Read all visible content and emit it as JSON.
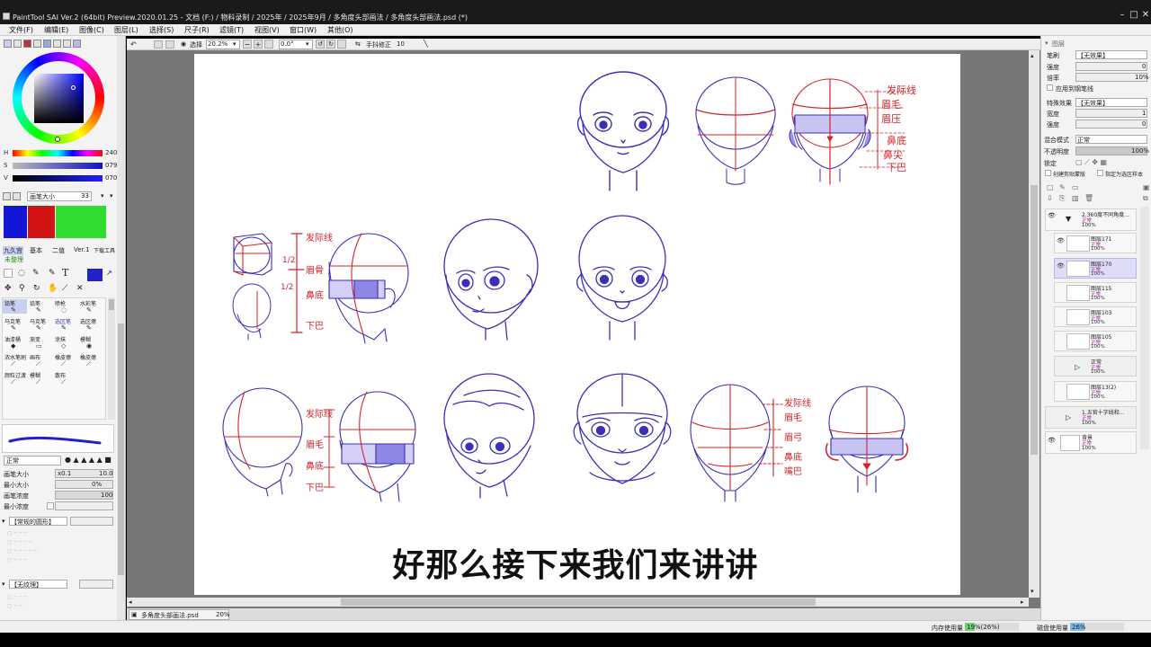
{
  "window": {
    "title": "PaintTool SAI Ver.2 (64bit) Preview.2020.01.25 - 文档 (F:) / 物料录制 / 2025年 / 2025年9月 / 多角度头部画法 / 多角度头部画法.psd (*)",
    "min": "–",
    "max": "□",
    "close": "✕"
  },
  "menu": [
    "文件(F)",
    "编辑(E)",
    "图像(C)",
    "图层(L)",
    "选择(S)",
    "尺子(R)",
    "滤镜(T)",
    "视图(V)",
    "窗口(W)",
    "其他(O)"
  ],
  "colors": {
    "accent": "#3333cc",
    "sketch_blue": "#3a2fb8",
    "sketch_red": "#d4232a",
    "selection_purple": "#dedcf7",
    "mode_magenta": "#a0158f",
    "palette": [
      "#1515d6",
      "#d11313",
      "#2fdc2f"
    ],
    "current_color": "#2222cc"
  },
  "color_panel": {
    "hsv": [
      {
        "label": "H",
        "value": "240"
      },
      {
        "label": "S",
        "value": "079"
      },
      {
        "label": "V",
        "value": "070"
      }
    ],
    "brush_size_label": "画笔大小",
    "brush_size_value": "33"
  },
  "tool_panel": {
    "tabs": [
      "九久宫",
      "基本",
      "二值",
      "Ver.1",
      "下载工具"
    ],
    "sub_tab": "未整理",
    "tools": [
      [
        "铅笔",
        "铅笔",
        "喷枪",
        "水彩笔"
      ],
      [
        "马克笔",
        "马克笔",
        "选区笔",
        "选区擦"
      ],
      [
        "油漆桶",
        "渐变",
        "涂抹",
        "模糊"
      ],
      [
        "浓水笔刷",
        "画布",
        "橡皮擦",
        "橡皮擦"
      ],
      [
        "颜粒过渡",
        "模糊",
        "散布",
        ""
      ]
    ],
    "tool_icons": [
      "✎",
      "✎",
      "◌",
      "✎",
      "✎",
      "✎",
      "✎",
      "✎",
      "◆",
      "▭",
      "◇",
      "◉",
      "⟋",
      "⟋",
      "⟋",
      "⟋",
      "⟋",
      "⟋",
      "⟋",
      ""
    ],
    "blend_mode": "正常",
    "params": [
      {
        "label": "画笔大小",
        "multiplier": "x0.1",
        "value": "10.0"
      },
      {
        "label": "最小大小",
        "value": "0%"
      },
      {
        "label": "画笔浓度",
        "value": "100"
      },
      {
        "label": "最小浓度",
        "value": ""
      }
    ],
    "shape_label": "【常规的圆形】",
    "texture_label": "【无纹理】"
  },
  "canvas_toolbar": {
    "select_label": "选择",
    "zoom": "20.2%",
    "angle": "0.0°",
    "stabilizer_label": "手抖修正",
    "stabilizer_value": "10"
  },
  "right_panel": {
    "tab_title": "图层",
    "brush_label": "笔刷",
    "brush_value": "【无效果】",
    "strength_label": "强度",
    "strength_value": "0",
    "rate_label": "倍率",
    "rate_value": "10%",
    "apply_label": "应用到钢笔线",
    "effect_label": "特殊效果",
    "effect_value": "【无效果】",
    "width_label": "宽度",
    "width_value": "1",
    "intensity_label": "强度",
    "intensity_value": "0",
    "blend_label": "混合模式",
    "blend_value": "正常",
    "opacity_label": "不透明度",
    "opacity_value": "100%",
    "lock_label": "锁定",
    "clip_label": "创建剪贴蒙版",
    "sel_source_label": "指定为选区样本",
    "layers": [
      {
        "name": "2.360度不同角度...",
        "mode": "正常",
        "opacity": "100%",
        "folder": true
      },
      {
        "name": "图层171",
        "mode": "正常",
        "opacity": "100%"
      },
      {
        "name": "图层170",
        "mode": "正常",
        "opacity": "100%",
        "selected": true
      },
      {
        "name": "图层115",
        "mode": "正常",
        "opacity": "100%"
      },
      {
        "name": "图层103",
        "mode": "正常",
        "opacity": "100%"
      },
      {
        "name": "图层105",
        "mode": "正常",
        "opacity": "100%"
      },
      {
        "name": "正常",
        "mode": "正常",
        "opacity": "100%",
        "folder": true
      },
      {
        "name": "图层13(2)",
        "mode": "正常",
        "opacity": "100%"
      },
      {
        "name": "1.五官十字线和...",
        "mode": "正常",
        "opacity": "100%",
        "folder": true
      },
      {
        "name": "背景",
        "mode": "正常",
        "opacity": "100%"
      }
    ]
  },
  "doc_tab": {
    "name": "多角度头部画法.psd",
    "zoom": "20%"
  },
  "status": {
    "memory_label": "内存使用量",
    "memory_value": "19%(26%)",
    "memory_pct": 19,
    "disk_label": "磁盘使用量",
    "disk_value": "26%",
    "disk_pct": 26
  },
  "annotations": {
    "row1_right": [
      "发际线",
      "眉毛",
      "眉压",
      "鼻底",
      "鼻尖",
      "下巴"
    ],
    "row2_left": [
      "发际线",
      "眉骨",
      "鼻底",
      "下巴"
    ],
    "row2_frac": "1/2",
    "row2_ratio": "1/2",
    "row3_left": [
      "发际线",
      "眉毛",
      "鼻底",
      "下巴"
    ],
    "row3_right": [
      "发际线",
      "眉毛",
      "眉弓",
      "鼻底",
      "嘴巴"
    ]
  },
  "subtitle": "好那么接下来我们来讲讲"
}
